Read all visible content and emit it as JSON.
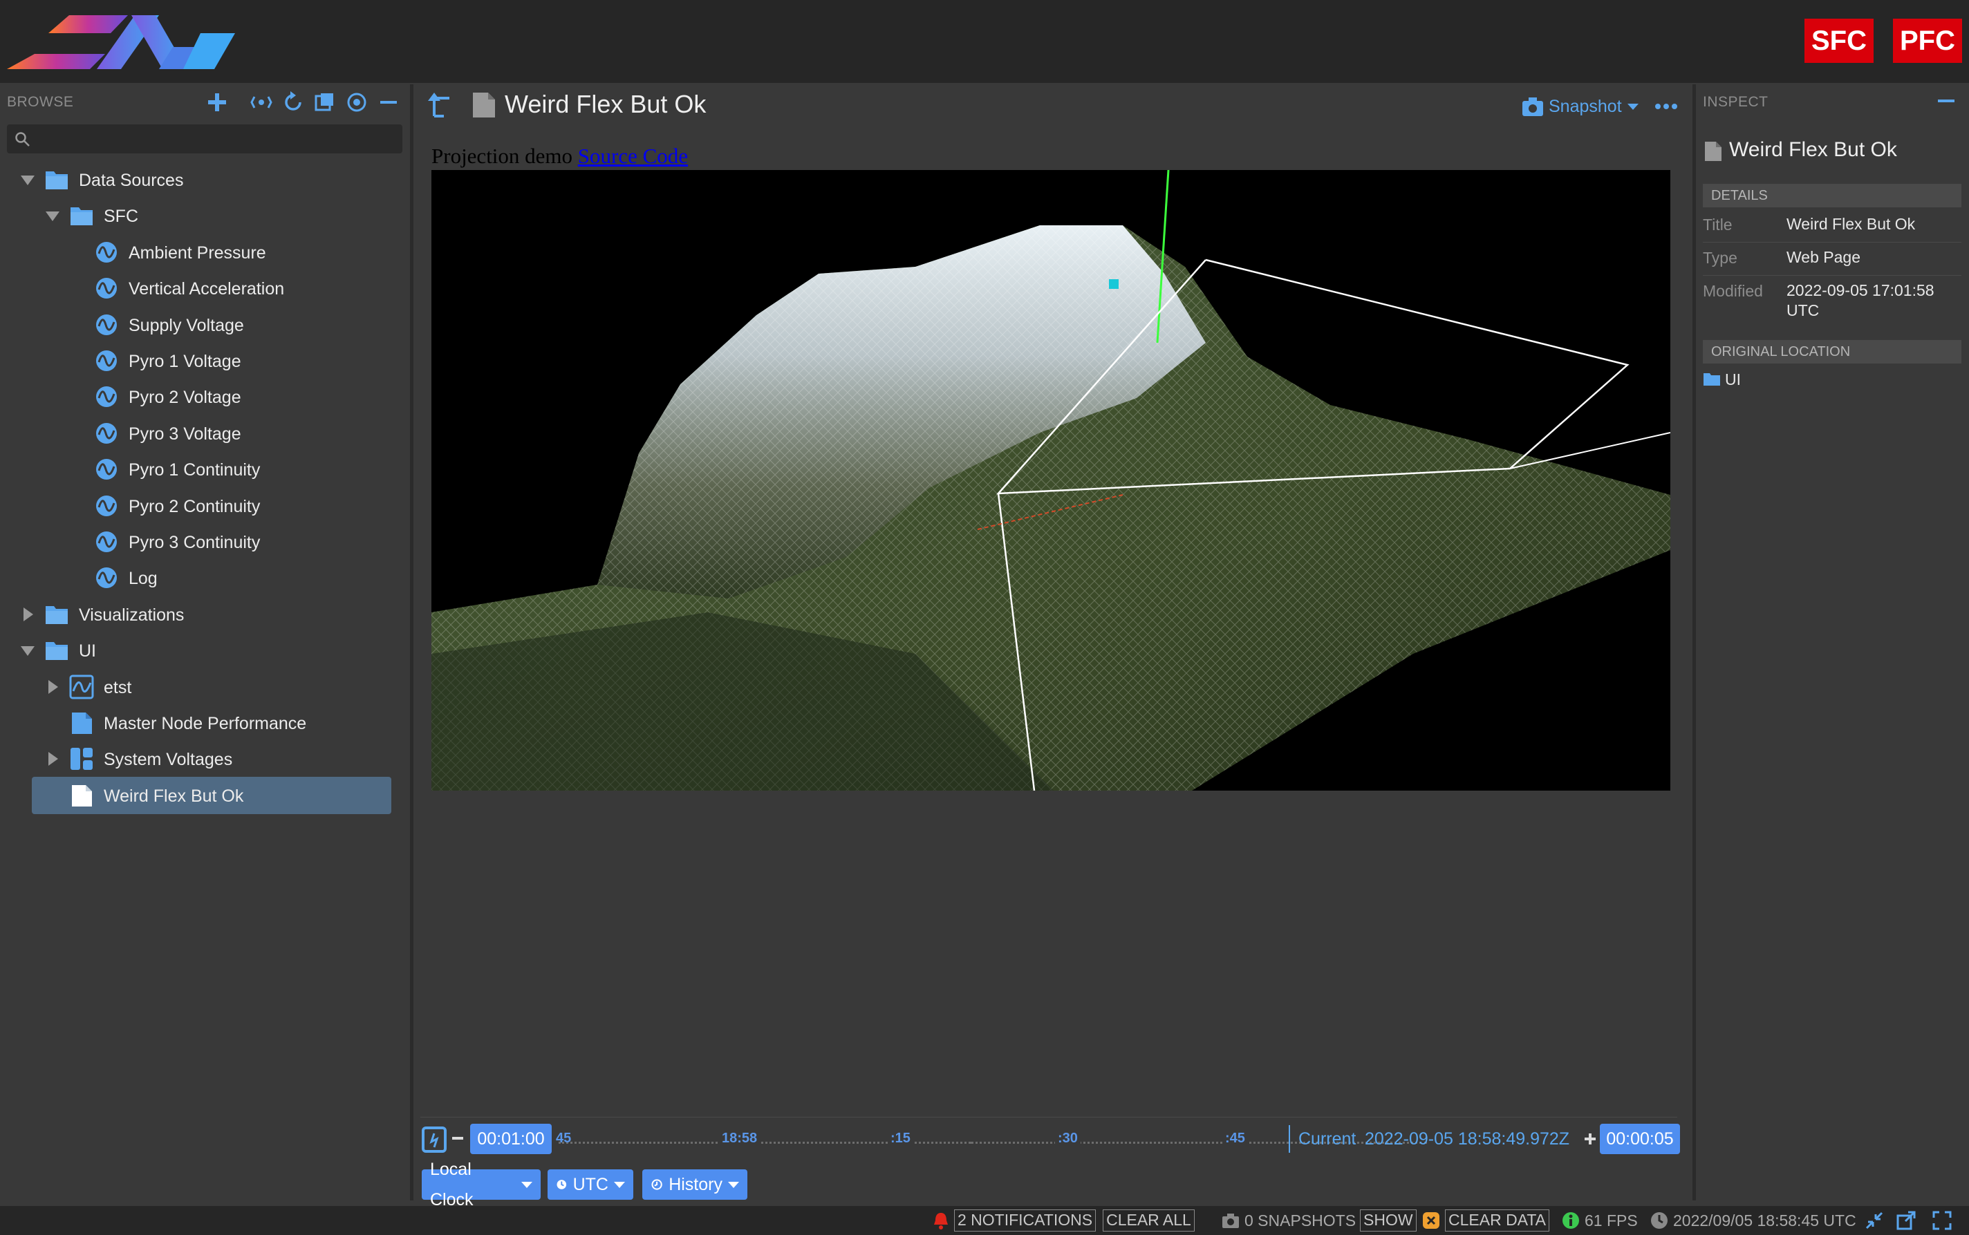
{
  "header": {
    "badges": [
      "SFC",
      "PFC"
    ]
  },
  "browse": {
    "label": "BROWSE",
    "search_placeholder": "",
    "tree": [
      {
        "label": "Data Sources",
        "icon": "folder-icon",
        "arrow": "expanded"
      },
      {
        "label": "SFC",
        "icon": "folder-icon",
        "arrow": "expanded"
      },
      {
        "label": "Ambient Pressure",
        "icon": "telemetry-icon",
        "arrow": "none"
      },
      {
        "label": "Vertical Acceleration",
        "icon": "telemetry-icon",
        "arrow": "none"
      },
      {
        "label": "Supply Voltage",
        "icon": "telemetry-icon",
        "arrow": "none"
      },
      {
        "label": "Pyro 1 Voltage",
        "icon": "telemetry-icon",
        "arrow": "none"
      },
      {
        "label": "Pyro 2 Voltage",
        "icon": "telemetry-icon",
        "arrow": "none"
      },
      {
        "label": "Pyro 3 Voltage",
        "icon": "telemetry-icon",
        "arrow": "none"
      },
      {
        "label": "Pyro 1 Continuity",
        "icon": "telemetry-icon",
        "arrow": "none"
      },
      {
        "label": "Pyro 2 Continuity",
        "icon": "telemetry-icon",
        "arrow": "none"
      },
      {
        "label": "Pyro 3 Continuity",
        "icon": "telemetry-icon",
        "arrow": "none"
      },
      {
        "label": "Log",
        "icon": "telemetry-icon",
        "arrow": "none"
      },
      {
        "label": "Visualizations",
        "icon": "folder-icon",
        "arrow": "collapsed"
      },
      {
        "label": "UI",
        "icon": "folder-icon",
        "arrow": "expanded"
      },
      {
        "label": "etst",
        "icon": "plot-icon",
        "arrow": "collapsed"
      },
      {
        "label": "Master Node Performance",
        "icon": "page-icon",
        "arrow": "none"
      },
      {
        "label": "System Voltages",
        "icon": "layout-icon",
        "arrow": "collapsed"
      },
      {
        "label": "Weird Flex But Ok",
        "icon": "page-icon",
        "arrow": "none",
        "selected": true
      }
    ]
  },
  "main": {
    "title": "Weird Flex But Ok",
    "snapshot_label": "Snapshot",
    "web": {
      "caption_text": "Projection demo",
      "link_text": "Source Code"
    }
  },
  "time": {
    "span_left": "00:01:00",
    "ticks": [
      "45",
      "18:58",
      ":15",
      ":30",
      ":45"
    ],
    "current_label": "Current",
    "current_value": "2022-09-05 18:58:49.972Z",
    "span_right": "00:00:05",
    "clock": "Local Clock",
    "timezone": "UTC",
    "mode": "History"
  },
  "inspect": {
    "label": "INSPECT",
    "title": "Weird Flex But Ok",
    "details_header": "DETAILS",
    "details": [
      {
        "key": "Title",
        "value": "Weird Flex But Ok"
      },
      {
        "key": "Type",
        "value": "Web Page"
      },
      {
        "key": "Modified",
        "value": "2022-09-05 17:01:58 UTC"
      }
    ],
    "location_header": "ORIGINAL LOCATION",
    "location": "UI"
  },
  "status": {
    "notifications": "2 NOTIFICATIONS",
    "clear_all": "CLEAR ALL",
    "snapshots": "0 SNAPSHOTS",
    "show": "SHOW",
    "clear_data": "CLEAR DATA",
    "fps": "61 FPS",
    "clock": "2022/09/05 18:58:45 UTC"
  },
  "colors": {
    "accent": "#5aa6ee",
    "badge": "#d9000a",
    "chip": "#4f8ef0",
    "selected_row": "#4f6a84"
  }
}
